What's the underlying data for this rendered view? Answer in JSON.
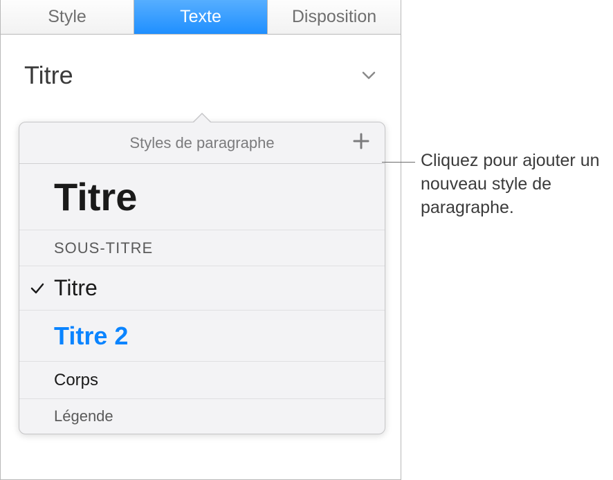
{
  "tabs": [
    {
      "label": "Style"
    },
    {
      "label": "Texte"
    },
    {
      "label": "Disposition"
    }
  ],
  "activeTab": 1,
  "currentStyle": "Titre",
  "popover": {
    "title": "Styles de paragraphe",
    "items": [
      {
        "label": "Titre",
        "class": "titre-big",
        "checked": false
      },
      {
        "label": "Sous-titre",
        "class": "sous-titre",
        "checked": false
      },
      {
        "label": "Titre",
        "class": "heading1",
        "checked": true
      },
      {
        "label": "Titre 2",
        "class": "heading2",
        "checked": false
      },
      {
        "label": "Corps",
        "class": "body",
        "checked": false
      },
      {
        "label": "Légende",
        "class": "caption",
        "checked": false
      }
    ]
  },
  "callout": "Cliquez pour ajouter un nouveau style de paragraphe."
}
